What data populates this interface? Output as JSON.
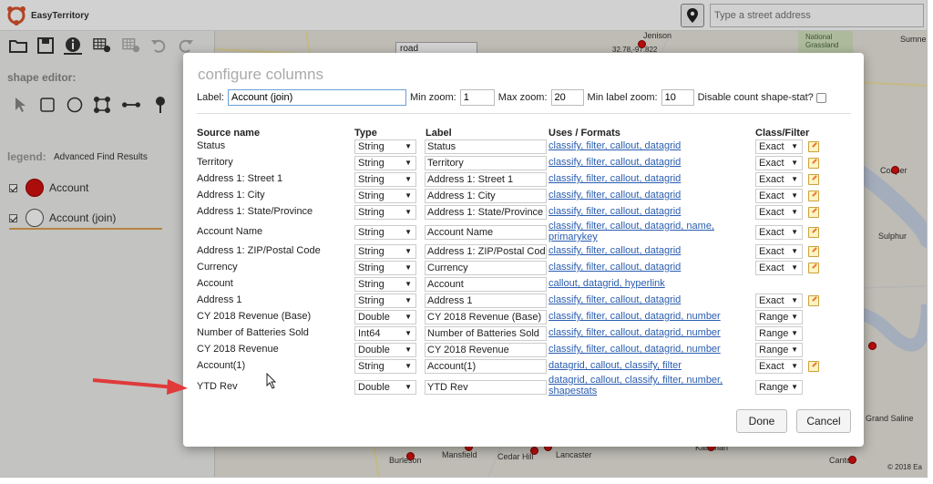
{
  "app": {
    "brand": "EasyTerritory"
  },
  "address_search": {
    "placeholder": "Type a street address"
  },
  "toolbar": {
    "icons": [
      "folder-icon",
      "save-icon",
      "info-icon",
      "add-grid-icon",
      "remove-grid-icon",
      "undo-icon",
      "redo-icon"
    ]
  },
  "shape_editor": {
    "label": "shape editor:"
  },
  "legend": {
    "title": "legend:",
    "subtitle": "Advanced Find Results",
    "items": [
      {
        "label": "Account",
        "checked": true,
        "color": "#d11111"
      },
      {
        "label": "Account (join)",
        "checked": true,
        "color": "#ffffff"
      }
    ]
  },
  "map": {
    "road_select": "road",
    "labels": [
      "Sumner",
      "National Grassland",
      "Cooper",
      "Sulphur",
      "Grand Saline",
      "Burleson",
      "Mansfield",
      "Cedar Hill",
      "Lancaster",
      "Kaufman",
      "Canton",
      "Jenison",
      "32.78,-97.822",
      "© 2018 Ea"
    ]
  },
  "modal": {
    "title": "configure columns",
    "label_label": "Label:",
    "label_value": "Account (join)",
    "min_zoom_label": "Min zoom:",
    "min_zoom_value": "1",
    "max_zoom_label": "Max zoom:",
    "max_zoom_value": "20",
    "min_label_zoom_label": "Min label zoom:",
    "min_label_zoom_value": "10",
    "disable_count_label": "Disable count shape-stat?",
    "headers": {
      "source": "Source name",
      "type": "Type",
      "label": "Label",
      "uses": "Uses / Formats",
      "class": "Class/Filter"
    },
    "rows": [
      {
        "source": "Status",
        "type": "String",
        "label": "Status",
        "uses": "classify, filter, callout, datagrid",
        "class": "Exact",
        "edit": true
      },
      {
        "source": "Territory",
        "type": "String",
        "label": "Territory",
        "uses": "classify, filter, callout, datagrid",
        "class": "Exact",
        "edit": true
      },
      {
        "source": "Address 1: Street 1",
        "type": "String",
        "label": "Address 1: Street 1",
        "uses": "classify, filter, callout, datagrid",
        "class": "Exact",
        "edit": true
      },
      {
        "source": "Address 1: City",
        "type": "String",
        "label": "Address 1: City",
        "uses": "classify, filter, callout, datagrid",
        "class": "Exact",
        "edit": true
      },
      {
        "source": "Address 1: State/Province",
        "type": "String",
        "label": "Address 1: State/Province",
        "uses": "classify, filter, callout, datagrid",
        "class": "Exact",
        "edit": true
      },
      {
        "source": "Account Name",
        "type": "String",
        "label": "Account Name",
        "uses": "classify, filter, callout, datagrid, name, primarykey",
        "class": "Exact",
        "edit": true
      },
      {
        "source": "Address 1: ZIP/Postal Code",
        "type": "String",
        "label": "Address 1: ZIP/Postal Code",
        "uses": "classify, filter, callout, datagrid",
        "class": "Exact",
        "edit": true
      },
      {
        "source": "Currency",
        "type": "String",
        "label": "Currency",
        "uses": "classify, filter, callout, datagrid",
        "class": "Exact",
        "edit": true
      },
      {
        "source": "Account",
        "type": "String",
        "label": "Account",
        "uses": "callout, datagrid, hyperlink",
        "class": "",
        "edit": false
      },
      {
        "source": "Address 1",
        "type": "String",
        "label": "Address 1",
        "uses": "classify, filter, callout, datagrid",
        "class": "Exact",
        "edit": true
      },
      {
        "source": "CY 2018 Revenue (Base)",
        "type": "Double",
        "label": "CY 2018 Revenue (Base)",
        "uses": "classify, filter, callout, datagrid, number",
        "class": "Range",
        "edit": false
      },
      {
        "source": "Number of Batteries Sold",
        "type": "Int64",
        "label": "Number of Batteries Sold",
        "uses": "classify, filter, callout, datagrid, number",
        "class": "Range",
        "edit": false
      },
      {
        "source": "CY 2018 Revenue",
        "type": "Double",
        "label": "CY 2018 Revenue",
        "uses": "classify, filter, callout, datagrid, number",
        "class": "Range",
        "edit": false
      },
      {
        "source": "Account(1)",
        "type": "String",
        "label": "Account(1)",
        "uses": "datagrid, callout, classify, filter",
        "class": "Exact",
        "edit": true
      },
      {
        "source": "YTD Rev",
        "type": "Double",
        "label": "YTD Rev",
        "uses": "datagrid, callout, classify, filter, number, shapestats",
        "class": "Range",
        "edit": false
      }
    ],
    "done_label": "Done",
    "cancel_label": "Cancel"
  }
}
